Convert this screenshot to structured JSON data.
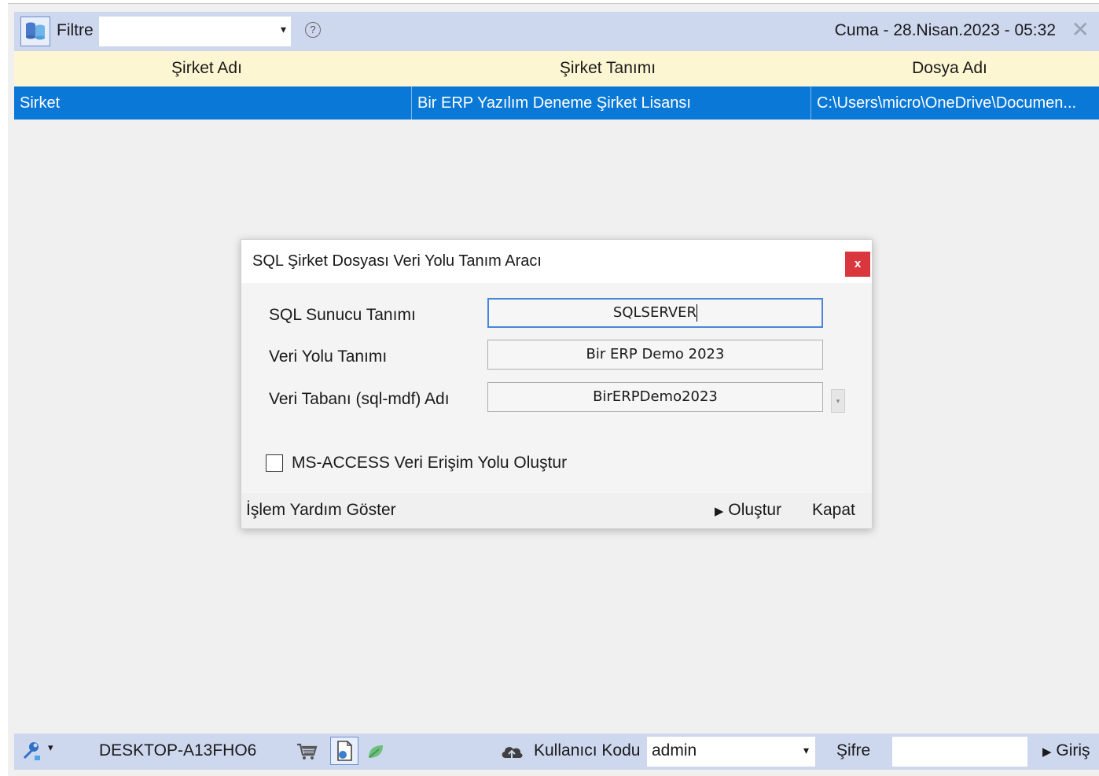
{
  "toolbar": {
    "filter_label": "Filtre",
    "filter_value": "",
    "help_glyph": "?",
    "datetime": "Cuma - 28.Nisan.2023 - 05:32",
    "close_glyph": "✕",
    "db_icon": "database-filter-icon",
    "combo_arrow": "▾"
  },
  "grid": {
    "columns": [
      "Şirket Adı",
      "Şirket Tanımı",
      "Dosya Adı"
    ],
    "rows": [
      {
        "name": "Sirket",
        "description": "Bir ERP Yazılım Deneme Şirket Lisansı",
        "file": "C:\\Users\\micro\\OneDrive\\Documen..."
      }
    ],
    "selected_color": "#0a78d7",
    "header_color": "#fdf6d2"
  },
  "dialog": {
    "title": "SQL Şirket Dosyası Veri Yolu Tanım Aracı",
    "close_glyph": "x",
    "fields": [
      {
        "label": "SQL Sunucu Tanımı",
        "value": "SQLSERVER"
      },
      {
        "label": "Veri Yolu Tanımı",
        "value": "Bir ERP Demo 2023"
      },
      {
        "label": "Veri Tabanı (sql-mdf) Adı",
        "value": "BirERPDemo2023"
      }
    ],
    "dropdown_glyph": "▾",
    "checkbox_label": "MS-ACCESS Veri Erişim Yolu Oluştur",
    "checkbox_checked": false,
    "footer": {
      "help": "İşlem Yardım Göster",
      "create": "Oluştur",
      "close": "Kapat",
      "play_glyph": "▶"
    }
  },
  "statusbar": {
    "computer_name": "DESKTOP-A13FHO6",
    "user_label": "Kullanıcı Kodu",
    "user_value": "admin",
    "password_label": "Şifre",
    "password_value": "",
    "login": "Giriş",
    "play_glyph": "▶",
    "combo_arrow": "▾",
    "tools_arrow": "▾",
    "icons": [
      "tools-icon",
      "cart-icon",
      "document-icon",
      "leaf-icon",
      "cloud-icon"
    ]
  }
}
